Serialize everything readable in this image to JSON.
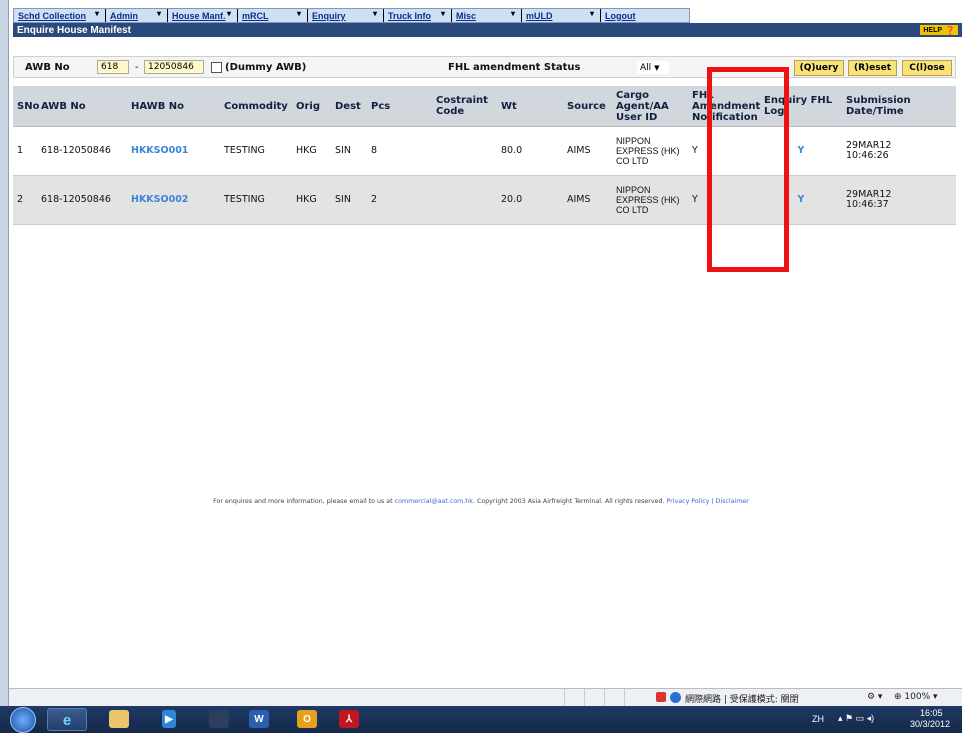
{
  "menu": [
    {
      "label": "Schd Collection",
      "w": 0
    },
    {
      "label": "Admin"
    },
    {
      "label": "House Manf."
    },
    {
      "label": "mRCL"
    },
    {
      "label": "Enquiry"
    },
    {
      "label": "Truck Info"
    },
    {
      "label": "Misc"
    },
    {
      "label": "mULD"
    },
    {
      "label": "Logout"
    }
  ],
  "page": {
    "title": "Enquire House Manifest",
    "help": "HELP"
  },
  "search": {
    "awb_label": "AWB No",
    "awb_prefix": "618",
    "dash": "-",
    "awb_number": "12050846",
    "dummy_label": "(Dummy AWB)",
    "status_label": "FHL amendment Status",
    "status_value": "All",
    "query_btn": "(Q)uery",
    "reset_btn": "(R)eset",
    "close_btn": "C(l)ose"
  },
  "table": {
    "headers": [
      "SNo",
      "AWB No",
      "HAWB No",
      "Commodity",
      "Orig",
      "Dest",
      "Pcs",
      "Costraint Code",
      "Wt",
      "Source",
      "Cargo Agent/AA User ID",
      "FHL Amendment Notification",
      "Enquiry FHL Log",
      "Submission Date/Time"
    ],
    "rows": [
      {
        "sno": "1",
        "awb": "618-12050846",
        "hawb": "HKKSO001",
        "commodity": "TESTING",
        "orig": "HKG",
        "dest": "SIN",
        "pcs": "8",
        "code": "",
        "wt": "80.0",
        "source": "AIMS",
        "agent": "NIPPON EXPRESS (HK) CO LTD",
        "fhl": "Y",
        "log": "Y",
        "date": "29MAR12",
        "time": "10:46:26"
      },
      {
        "sno": "2",
        "awb": "618-12050846",
        "hawb": "HKKSO002",
        "commodity": "TESTING",
        "orig": "HKG",
        "dest": "SIN",
        "pcs": "2",
        "code": "",
        "wt": "20.0",
        "source": "AIMS",
        "agent": "NIPPON EXPRESS (HK) CO LTD",
        "fhl": "Y",
        "log": "Y",
        "date": "29MAR12",
        "time": "10:46:37"
      }
    ]
  },
  "footer": {
    "text1": "For enquires and more information, please email to us at ",
    "email": "commercial@aat.com.hk",
    "text2": ". Copyright 2003 Asia Airfreight Terminal. All rights reserved. ",
    "privacy": "Privacy Policy",
    "sep": " | ",
    "disclaimer": "Disclaimer"
  },
  "statusbar": {
    "zone": "網際網路 | 受保護模式: 關閉",
    "zoom": "100%"
  },
  "taskbar": {
    "lang": "ZH",
    "time": "16:05",
    "date": "30/3/2012"
  },
  "colors": {
    "accent": "#2a4a7c",
    "link": "#3a86d6",
    "highlight": "#ee1111"
  }
}
